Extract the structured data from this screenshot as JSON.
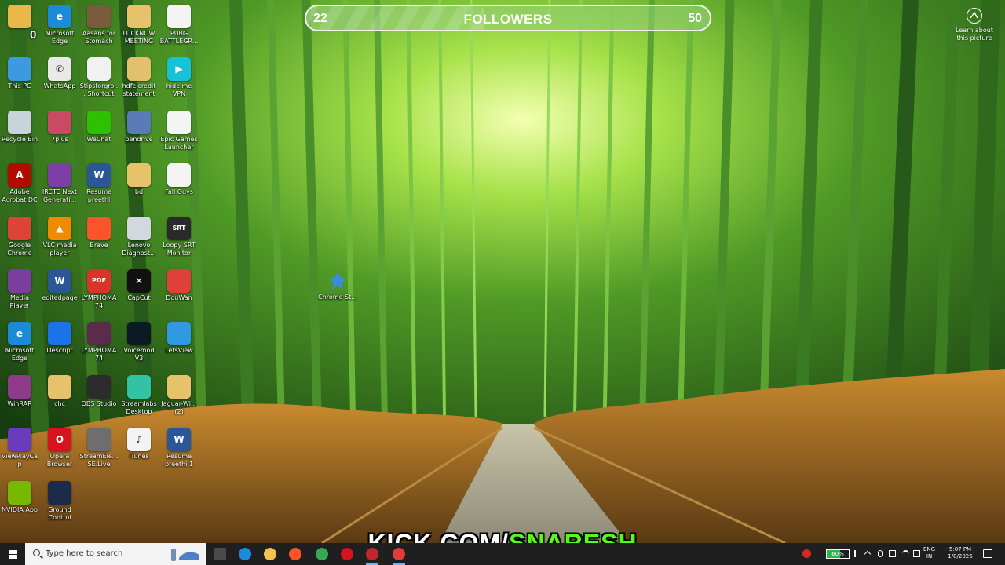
{
  "desktop": {
    "icons": [
      {
        "label": "",
        "glyph": "",
        "color": "#e8b948"
      },
      {
        "label": "Microsoft Edge",
        "glyph": "e",
        "color": "#1b8ad8"
      },
      {
        "label": "Aasans for Stomach Di...",
        "glyph": "",
        "color": "#7a5b3c"
      },
      {
        "label": "LUCKNOW MEETING",
        "glyph": "",
        "color": "#e6c36a"
      },
      {
        "label": "PUBG BATTLEGR...",
        "glyph": "",
        "color": "#f4f4f4"
      },
      {
        "label": "This PC",
        "glyph": "",
        "color": "#3d9ae0"
      },
      {
        "label": "WhatsApp",
        "glyph": "✆",
        "color": "#e9e9e9"
      },
      {
        "label": "Stipsforgro... Shortcut",
        "glyph": "",
        "color": "#f1f1f1"
      },
      {
        "label": "hdfc credit statement",
        "glyph": "",
        "color": "#e3c06c"
      },
      {
        "label": "hide.me VPN",
        "glyph": "▶",
        "color": "#16c2d6"
      },
      {
        "label": "Recycle Bin",
        "glyph": "",
        "color": "#c8d4dc"
      },
      {
        "label": "7plus",
        "glyph": "",
        "color": "#c94a64"
      },
      {
        "label": "WeChat",
        "glyph": "",
        "color": "#2dc100"
      },
      {
        "label": "pendrive",
        "glyph": "",
        "color": "#5a7bb8"
      },
      {
        "label": "Epic Games Launcher",
        "glyph": "",
        "color": "#f4f4f4"
      },
      {
        "label": "Adobe Acrobat DC",
        "glyph": "A",
        "color": "#b30b00"
      },
      {
        "label": "IRCTC Next Generati...",
        "glyph": "",
        "color": "#7b3fa5"
      },
      {
        "label": "Resume preethi",
        "glyph": "W",
        "color": "#2b5797"
      },
      {
        "label": "bd",
        "glyph": "",
        "color": "#e6c36a"
      },
      {
        "label": "Fall Guys",
        "glyph": "",
        "color": "#f4f4f4"
      },
      {
        "label": "Google Chrome",
        "glyph": "",
        "color": "#db4437"
      },
      {
        "label": "VLC media player",
        "glyph": "▲",
        "color": "#f08a00"
      },
      {
        "label": "Brave",
        "glyph": "",
        "color": "#fb542b"
      },
      {
        "label": "Lenovo Diagnost...",
        "glyph": "",
        "color": "#d2d8de"
      },
      {
        "label": "Loopy SRT Monitor",
        "glyph": "SRT",
        "color": "#2a2a2a"
      },
      {
        "label": "Media Player Classic",
        "glyph": "",
        "color": "#7a3e9e"
      },
      {
        "label": "editedpage",
        "glyph": "W",
        "color": "#2b5797"
      },
      {
        "label": "LYMPHOMA 74",
        "glyph": "PDF",
        "color": "#d9342b"
      },
      {
        "label": "CapCut",
        "glyph": "✕",
        "color": "#111111"
      },
      {
        "label": "DouWan",
        "glyph": "",
        "color": "#e0403a"
      },
      {
        "label": "Microsoft Edge",
        "glyph": "e",
        "color": "#1b8ad8"
      },
      {
        "label": "Descript",
        "glyph": "",
        "color": "#1a73e8"
      },
      {
        "label": "LYMPHOMA 74",
        "glyph": "",
        "color": "#5a2b4a"
      },
      {
        "label": "Voicemod V3",
        "glyph": "",
        "color": "#0c1a24"
      },
      {
        "label": "LetsView",
        "glyph": "",
        "color": "#2f9ae0"
      },
      {
        "label": "WinRAR",
        "glyph": "",
        "color": "#8e3b8a"
      },
      {
        "label": "chc",
        "glyph": "",
        "color": "#e6c36a"
      },
      {
        "label": "OBS Studio",
        "glyph": "",
        "color": "#2c2c2c"
      },
      {
        "label": "Streamlabs Desktop",
        "glyph": "",
        "color": "#31c3a2"
      },
      {
        "label": "Jaguar-Wi... (2)",
        "glyph": "",
        "color": "#e6c36a"
      },
      {
        "label": "ViewPlayCap",
        "glyph": "",
        "color": "#6b3bbd"
      },
      {
        "label": "Opera Browser",
        "glyph": "O",
        "color": "#d7131f"
      },
      {
        "label": "StreamEle... SE.Live",
        "glyph": "",
        "color": "#6e6e6e"
      },
      {
        "label": "iTunes",
        "glyph": "♪",
        "color": "#f3f3f3"
      },
      {
        "label": "Resume preethi 1",
        "glyph": "W",
        "color": "#2b5797"
      },
      {
        "label": "NVIDIA App",
        "glyph": "",
        "color": "#76b900"
      },
      {
        "label": "Ground Control",
        "glyph": "",
        "color": "#1d2b4a"
      }
    ],
    "loose_icon": {
      "label": "Chrome St...",
      "color": "#3b8ce0"
    }
  },
  "overlay": {
    "counter": "0",
    "followers": {
      "current": "22",
      "title": "FOLLOWERS",
      "goal": "50",
      "progress": 0.44
    },
    "learn_label": "Learn about this picture",
    "kick_white": "KICK.COM/",
    "kick_green": "SNARESH"
  },
  "taskbar": {
    "search_placeholder": "Type here to search",
    "battery": "60%",
    "lang_top": "ENG",
    "lang_bottom": "IN",
    "time": "5:07 PM",
    "date": "1/8/2026",
    "apps": [
      {
        "name": "task-view-icon",
        "color": "#4a4a4a"
      },
      {
        "name": "edge-taskbar-icon",
        "color": "#1b8ad8"
      },
      {
        "name": "file-explorer-icon",
        "color": "#f2c14e"
      },
      {
        "name": "brave-taskbar-icon",
        "color": "#fb542b"
      },
      {
        "name": "chrome-taskbar-icon",
        "color": "#34a853"
      },
      {
        "name": "opera-taskbar-icon",
        "color": "#d7131f"
      },
      {
        "name": "app-taskbar-icon-1",
        "color": "#c2272d"
      },
      {
        "name": "app-taskbar-icon-2",
        "color": "#e23b3b"
      }
    ]
  }
}
